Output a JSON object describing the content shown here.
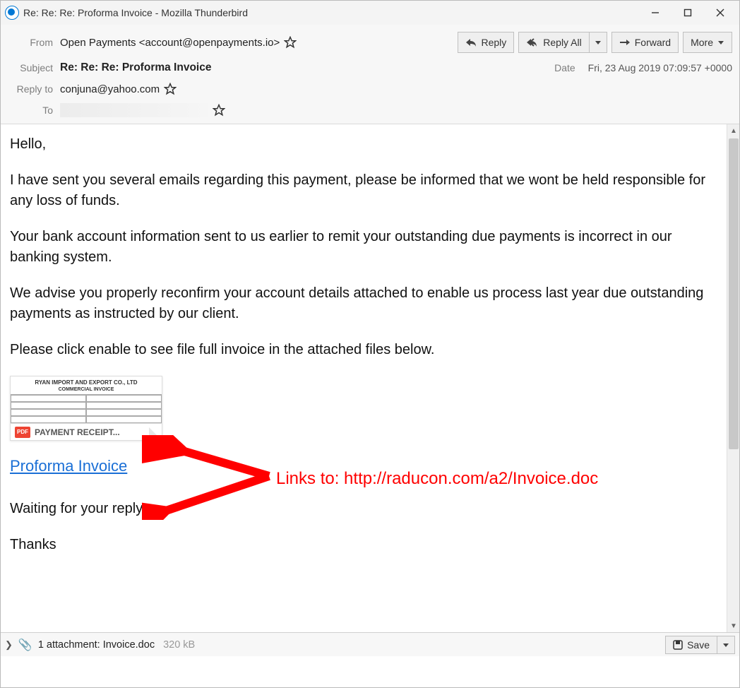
{
  "window": {
    "title": "Re: Re: Re: Proforma Invoice - Mozilla Thunderbird"
  },
  "actions": {
    "reply": "Reply",
    "reply_all": "Reply All",
    "forward": "Forward",
    "more": "More"
  },
  "headers": {
    "from_label": "From",
    "from_value": "Open Payments <account@openpayments.io>",
    "subject_label": "Subject",
    "subject_value": "Re: Re: Re: Proforma Invoice",
    "date_label": "Date",
    "date_value": "Fri, 23 Aug 2019 07:09:57 +0000",
    "reply_to_label": "Reply to",
    "reply_to_value": "conjuna@yahoo.com",
    "to_label": "To"
  },
  "body": {
    "p1": "Hello,",
    "p2": "I have sent you several emails regarding this payment, please be informed that we wont be held responsible for any loss of funds.",
    "p3": "Your bank account information sent to us earlier to remit your outstanding due payments is incorrect in our banking system.",
    "p4": "We advise you properly reconfirm your account details attached to enable us process last year due outstanding payments as instructed by our client.",
    "p5": "Please click enable to see file full invoice in the attached files below.",
    "preview_company": "RYAN IMPORT AND EXPORT CO., LTD",
    "preview_doc": "COMMERCIAL INVOICE",
    "preview_label": "PAYMENT RECEIPT...",
    "pdf_badge": "PDF",
    "link_text": "Proforma Invoice",
    "p6": "Waiting for your reply,",
    "p7": "Thanks"
  },
  "annotation": {
    "text": "Links to: http://raducon.com/a2/Invoice.doc"
  },
  "attach": {
    "summary": "1 attachment: Invoice.doc",
    "size": "320 kB",
    "save": "Save"
  }
}
